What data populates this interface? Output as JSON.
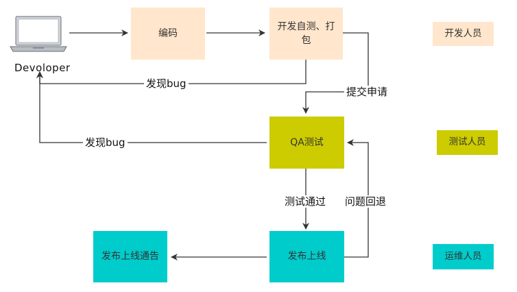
{
  "nodes": {
    "coding": "编码",
    "selftest": "开发自测、打包",
    "qa": "QA测试",
    "release": "发布上线",
    "notice": "发布上线通告"
  },
  "developer_label": "Devoloper",
  "edges": {
    "bug1": "发现bug",
    "bug2": "发现bug",
    "submit": "提交申请",
    "pass": "测试通过",
    "rollback": "问题回退"
  },
  "legend": {
    "dev": "开发人员",
    "qa": "测试人员",
    "ops": "运维人员"
  },
  "colors": {
    "dev": "#ffe6cc",
    "qa": "#cccc00",
    "ops": "#00cccc",
    "line": "#333333"
  }
}
